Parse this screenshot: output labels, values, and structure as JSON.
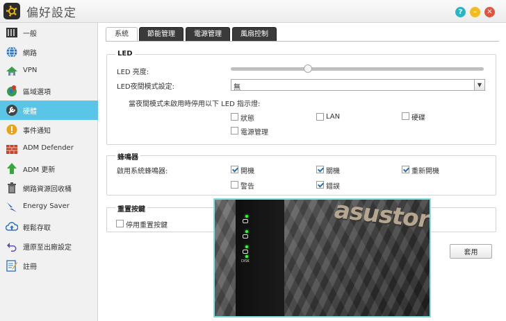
{
  "window": {
    "title": "偏好設定"
  },
  "sidebar": {
    "items": [
      {
        "label": "一般",
        "icon": "server-icon"
      },
      {
        "label": "網路",
        "icon": "globe-icon"
      },
      {
        "label": "VPN",
        "icon": "house-network-icon"
      },
      {
        "label": "區域選項",
        "icon": "globe-pin-icon"
      },
      {
        "label": "硬體",
        "icon": "wrench-icon"
      },
      {
        "label": "事件通知",
        "icon": "alert-icon"
      },
      {
        "label": "ADM Defender",
        "icon": "brick-wall-icon"
      },
      {
        "label": "ADM 更新",
        "icon": "arrow-up-icon"
      },
      {
        "label": "網路資源回收桶",
        "icon": "trash-icon"
      },
      {
        "label": "Energy Saver",
        "icon": "lightning-icon"
      },
      {
        "label": "輕鬆存取",
        "icon": "cloud-upload-icon"
      },
      {
        "label": "還原至出廠設定",
        "icon": "undo-icon"
      },
      {
        "label": "註冊",
        "icon": "register-icon"
      }
    ]
  },
  "tabs": [
    {
      "label": "系統"
    },
    {
      "label": "節能管理"
    },
    {
      "label": "電源管理"
    },
    {
      "label": "風扇控制"
    }
  ],
  "led": {
    "section_title": "LED",
    "brightness_label": "LED 亮度:",
    "brightness_level": 0.29,
    "night_mode_label": "LED夜間模式設定:",
    "night_mode_value": "無",
    "disable_hint": "當夜間模式未啟用時停用以下 LED 指示燈:",
    "options": [
      {
        "label": "狀態",
        "checked": false
      },
      {
        "label": "LAN",
        "checked": false
      },
      {
        "label": "硬碟",
        "checked": false
      },
      {
        "label": "電源管理",
        "checked": false
      }
    ]
  },
  "buzzer": {
    "section_title": "蜂鳴器",
    "enable_label": "啟用系統蜂鳴器:",
    "options": [
      {
        "label": "開機",
        "checked": true
      },
      {
        "label": "關機",
        "checked": true
      },
      {
        "label": "重新開機",
        "checked": true
      },
      {
        "label": "警告",
        "checked": false
      },
      {
        "label": "錯誤",
        "checked": true
      }
    ]
  },
  "reset": {
    "section_title": "重置按鍵",
    "disable_label": "停用重置按鍵",
    "checked": false
  },
  "footer": {
    "apply_label": "套用"
  },
  "photo": {
    "brand": "asustor",
    "disk_label": "DISK"
  },
  "colors": {
    "accent": "#5bc5e8",
    "help": "#27b6c7",
    "minimize": "#f2bb1f",
    "close": "#e5533f"
  }
}
